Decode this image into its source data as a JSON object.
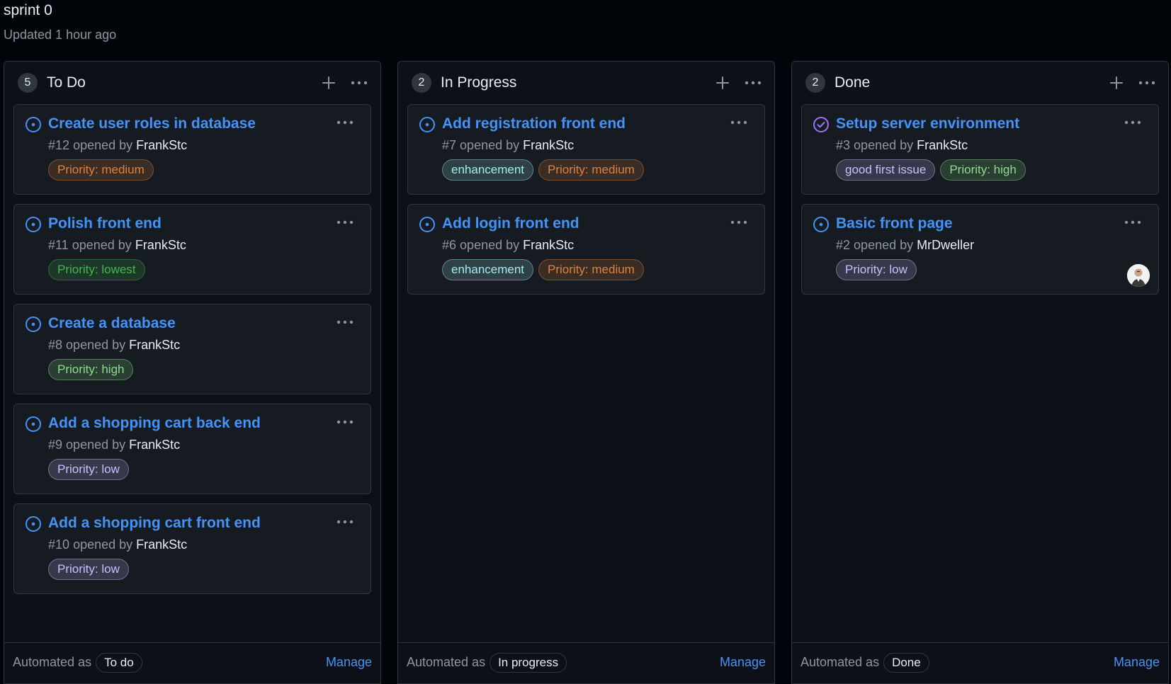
{
  "project": {
    "title": "sprint 0",
    "updated": "Updated 1 hour ago"
  },
  "colors": {
    "link": "#4493f8",
    "open_icon": "#4493f8",
    "closed_icon": "#a371f7",
    "priority_medium": "#e0823d",
    "priority_lowest": "#3fb950",
    "priority_high": "#8ddb8c",
    "priority_low": "#c8c0ff",
    "enhancement": "#a2eeef",
    "good_first_issue": "#c8c0ff"
  },
  "columns": [
    {
      "count": "5",
      "name": "To Do",
      "automated_label": "Automated as",
      "automated_value": "To do",
      "manage_label": "Manage",
      "cards": [
        {
          "title": "Create user roles in database",
          "number": "#12",
          "opened_by": "opened by",
          "author": "FrankStc",
          "status_icon": "open-issue-icon",
          "labels": [
            {
              "text": "Priority: medium",
              "color": "#e0823d"
            }
          ]
        },
        {
          "title": "Polish front end",
          "number": "#11",
          "opened_by": "opened by",
          "author": "FrankStc",
          "status_icon": "open-issue-icon",
          "labels": [
            {
              "text": "Priority: lowest",
              "color": "#3fb950"
            }
          ]
        },
        {
          "title": "Create a database",
          "number": "#8",
          "opened_by": "opened by",
          "author": "FrankStc",
          "status_icon": "open-issue-icon",
          "labels": [
            {
              "text": "Priority: high",
              "color": "#8ddb8c"
            }
          ]
        },
        {
          "title": "Add a shopping cart back end",
          "number": "#9",
          "opened_by": "opened by",
          "author": "FrankStc",
          "status_icon": "open-issue-icon",
          "labels": [
            {
              "text": "Priority: low",
              "color": "#c8c0ff"
            }
          ]
        },
        {
          "title": "Add a shopping cart front end",
          "number": "#10",
          "opened_by": "opened by",
          "author": "FrankStc",
          "status_icon": "open-issue-icon",
          "labels": [
            {
              "text": "Priority: low",
              "color": "#c8c0ff"
            }
          ]
        }
      ]
    },
    {
      "count": "2",
      "name": "In Progress",
      "automated_label": "Automated as",
      "automated_value": "In progress",
      "manage_label": "Manage",
      "cards": [
        {
          "title": "Add registration front end",
          "number": "#7",
          "opened_by": "opened by",
          "author": "FrankStc",
          "status_icon": "open-issue-icon",
          "labels": [
            {
              "text": "enhancement",
              "color": "#a2eeef"
            },
            {
              "text": "Priority: medium",
              "color": "#e0823d"
            }
          ]
        },
        {
          "title": "Add login front end",
          "number": "#6",
          "opened_by": "opened by",
          "author": "FrankStc",
          "status_icon": "open-issue-icon",
          "labels": [
            {
              "text": "enhancement",
              "color": "#a2eeef"
            },
            {
              "text": "Priority: medium",
              "color": "#e0823d"
            }
          ]
        }
      ]
    },
    {
      "count": "2",
      "name": "Done",
      "automated_label": "Automated as",
      "automated_value": "Done",
      "manage_label": "Manage",
      "cards": [
        {
          "title": "Setup server environment",
          "number": "#3",
          "opened_by": "opened by",
          "author": "FrankStc",
          "status_icon": "closed-issue-icon",
          "labels": [
            {
              "text": "good first issue",
              "color": "#c8c0ff"
            },
            {
              "text": "Priority: high",
              "color": "#8ddb8c"
            }
          ]
        },
        {
          "title": "Basic front page",
          "number": "#2",
          "opened_by": "opened by",
          "author": "MrDweller",
          "status_icon": "open-issue-icon",
          "assignee_avatar": true,
          "labels": [
            {
              "text": "Priority: low",
              "color": "#c8c0ff"
            }
          ]
        }
      ]
    }
  ]
}
